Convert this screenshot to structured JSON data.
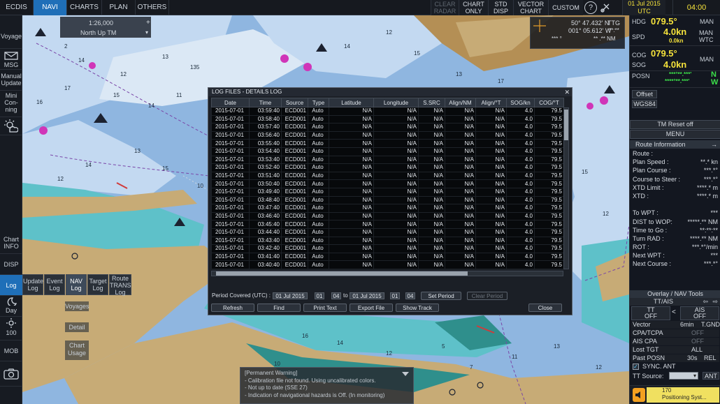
{
  "topbar": {
    "tabs": [
      {
        "label": "ECDIS",
        "active": false
      },
      {
        "label": "NAVI",
        "active": true
      },
      {
        "label": "CHARTS",
        "active": false
      },
      {
        "label": "PLAN",
        "active": false
      },
      {
        "label": "OTHERS",
        "active": false
      }
    ],
    "buttons": [
      "CLEAR\nRADAR",
      "CHART\nONLY",
      "STD\nDISP",
      "VECTOR\nCHART",
      "CUSTOM"
    ],
    "date": "01 Jul 2015",
    "date_zone": "UTC",
    "time": "04:00"
  },
  "left_menu": {
    "voyage": "Voyage",
    "msg": "MSG",
    "manual_update": "Manual\nUpdate",
    "mini_conning": "Mini\nCon-\nning",
    "chart_info": "Chart\nINFO",
    "disp": "DISP",
    "log": "Log",
    "day": "Day",
    "brightness": "100",
    "mob": "MOB"
  },
  "log_tabs": [
    {
      "label": "Update\nLog",
      "active": false
    },
    {
      "label": "Event\nLog",
      "active": false
    },
    {
      "label": "NAV\nLog",
      "active": true
    },
    {
      "label": "Target\nLog",
      "active": false
    },
    {
      "label": "Route\nTRANS\nLog",
      "active": false
    }
  ],
  "log_subitems": [
    "Voyages",
    "Detail",
    "Chart\nUsage"
  ],
  "chart_scale": {
    "scale": "1:26,000",
    "orientation": "North Up TM"
  },
  "cursor_readout": {
    "lat": "50° 47.432' N",
    "lon": "001° 05.612' W",
    "ttg": "TTG",
    "ttg_val": "**:**",
    "brg": "*** °",
    "rng": "** .** NM"
  },
  "nav": {
    "hdg_label": "HDG",
    "hdg": "079.5°",
    "hdg_mode": "MAN",
    "spd_label": "SPD",
    "spd": "4.0kn",
    "spd_sub": "0.0kn",
    "spd_mode": "MAN\nWTC",
    "cog_label": "COG",
    "cog": "079.5°",
    "cog_mode": "MAN",
    "sog_label": "SOG",
    "sog": "4.0kn",
    "posn_label": "POSN",
    "posn_lat": "***°**.***'",
    "posn_lat_dir": "N",
    "posn_lon": "****°**.***'",
    "posn_lon_dir": "W",
    "offset": "Offset",
    "datum": "WGS84"
  },
  "right_buttons": {
    "tm_reset": "TM Reset off",
    "menu": "MENU"
  },
  "route_info": {
    "title": "Route Information",
    "rows": [
      {
        "label": "Route :",
        "value": ""
      },
      {
        "label": "Plan Speed :",
        "value": "**.* kn"
      },
      {
        "label": "Plan Course :",
        "value": "***.*°"
      },
      {
        "label": "Course to Steer :",
        "value": "***.*°"
      },
      {
        "label": "XTD Limit :",
        "value": "****.* m"
      },
      {
        "label": "XTD :",
        "value": "****.* m"
      },
      {
        "label": "",
        "value": ""
      },
      {
        "label": "To WPT :",
        "value": "***"
      },
      {
        "label": "DIST to WOP:",
        "value": "*****.** NM"
      },
      {
        "label": "Time to Go :",
        "value": "**:**:**"
      },
      {
        "label": "Turn RAD :",
        "value": "****.** NM"
      },
      {
        "label": "ROT :",
        "value": "***.*°/min"
      },
      {
        "label": "Next WPT :",
        "value": "***"
      },
      {
        "label": "Next Course :",
        "value": "***.*°"
      }
    ]
  },
  "overlay": {
    "title": "Overlay / NAV Tools",
    "tab": "TT/AIS",
    "tt": "TT",
    "tt_state": "OFF",
    "ais": "AIS",
    "ais_state": "OFF",
    "vector": "Vector",
    "vector_time": "6min",
    "vector_mode": "T.GND",
    "cpa_tcpa": "CPA/TCPA",
    "cpa_state": "OFF",
    "ais_cpa": "AIS CPA",
    "ais_cpa_state": "OFF",
    "lost_tgt": "Lost TGT",
    "lost_state": "ALL",
    "past_posn": "Past POSN",
    "past_time": "30s",
    "past_mode": "REL",
    "sync_ant": "SYNC. ANT",
    "tt_source": "TT Source:",
    "ant": "ANT"
  },
  "alert": {
    "code": "170",
    "text": "Positioning Syst..."
  },
  "dialog": {
    "title": "LOG FILES - DETAILS LOG",
    "columns": [
      "Date",
      "Time",
      "Source",
      "Type",
      "Latitude",
      "Longitude",
      "S.SRC",
      "Align/NM",
      "Align/°T",
      "SOG/kn",
      "COG/°T"
    ],
    "rows": [
      [
        "2015-07-01",
        "03:59:40",
        "ECD001",
        "Auto",
        "N/A",
        "N/A",
        "N/A",
        "N/A",
        "N/A",
        "4.0",
        "79.5"
      ],
      [
        "2015-07-01",
        "03:58:40",
        "ECD001",
        "Auto",
        "N/A",
        "N/A",
        "N/A",
        "N/A",
        "N/A",
        "4.0",
        "79.5"
      ],
      [
        "2015-07-01",
        "03:57:40",
        "ECD001",
        "Auto",
        "N/A",
        "N/A",
        "N/A",
        "N/A",
        "N/A",
        "4.0",
        "79.5"
      ],
      [
        "2015-07-01",
        "03:56:40",
        "ECD001",
        "Auto",
        "N/A",
        "N/A",
        "N/A",
        "N/A",
        "N/A",
        "4.0",
        "79.5"
      ],
      [
        "2015-07-01",
        "03:55:40",
        "ECD001",
        "Auto",
        "N/A",
        "N/A",
        "N/A",
        "N/A",
        "N/A",
        "4.0",
        "79.5"
      ],
      [
        "2015-07-01",
        "03:54:40",
        "ECD001",
        "Auto",
        "N/A",
        "N/A",
        "N/A",
        "N/A",
        "N/A",
        "4.0",
        "79.5"
      ],
      [
        "2015-07-01",
        "03:53:40",
        "ECD001",
        "Auto",
        "N/A",
        "N/A",
        "N/A",
        "N/A",
        "N/A",
        "4.0",
        "79.5"
      ],
      [
        "2015-07-01",
        "03:52:40",
        "ECD001",
        "Auto",
        "N/A",
        "N/A",
        "N/A",
        "N/A",
        "N/A",
        "4.0",
        "79.5"
      ],
      [
        "2015-07-01",
        "03:51:40",
        "ECD001",
        "Auto",
        "N/A",
        "N/A",
        "N/A",
        "N/A",
        "N/A",
        "4.0",
        "79.5"
      ],
      [
        "2015-07-01",
        "03:50:40",
        "ECD001",
        "Auto",
        "N/A",
        "N/A",
        "N/A",
        "N/A",
        "N/A",
        "4.0",
        "79.5"
      ],
      [
        "2015-07-01",
        "03:49:40",
        "ECD001",
        "Auto",
        "N/A",
        "N/A",
        "N/A",
        "N/A",
        "N/A",
        "4.0",
        "79.5"
      ],
      [
        "2015-07-01",
        "03:48:40",
        "ECD001",
        "Auto",
        "N/A",
        "N/A",
        "N/A",
        "N/A",
        "N/A",
        "4.0",
        "79.5"
      ],
      [
        "2015-07-01",
        "03:47:40",
        "ECD001",
        "Auto",
        "N/A",
        "N/A",
        "N/A",
        "N/A",
        "N/A",
        "4.0",
        "79.5"
      ],
      [
        "2015-07-01",
        "03:46:40",
        "ECD001",
        "Auto",
        "N/A",
        "N/A",
        "N/A",
        "N/A",
        "N/A",
        "4.0",
        "79.5"
      ],
      [
        "2015-07-01",
        "03:45:40",
        "ECD001",
        "Auto",
        "N/A",
        "N/A",
        "N/A",
        "N/A",
        "N/A",
        "4.0",
        "79.5"
      ],
      [
        "2015-07-01",
        "03:44:40",
        "ECD001",
        "Auto",
        "N/A",
        "N/A",
        "N/A",
        "N/A",
        "N/A",
        "4.0",
        "79.5"
      ],
      [
        "2015-07-01",
        "03:43:40",
        "ECD001",
        "Auto",
        "N/A",
        "N/A",
        "N/A",
        "N/A",
        "N/A",
        "4.0",
        "79.5"
      ],
      [
        "2015-07-01",
        "03:42:40",
        "ECD001",
        "Auto",
        "N/A",
        "N/A",
        "N/A",
        "N/A",
        "N/A",
        "4.0",
        "79.5"
      ],
      [
        "2015-07-01",
        "03:41:40",
        "ECD001",
        "Auto",
        "N/A",
        "N/A",
        "N/A",
        "N/A",
        "N/A",
        "4.0",
        "79.5"
      ],
      [
        "2015-07-01",
        "03:40:40",
        "ECD001",
        "Auto",
        "N/A",
        "N/A",
        "N/A",
        "N/A",
        "N/A",
        "4.0",
        "79.5"
      ]
    ],
    "period_label": "Period Covered (UTC) :",
    "from_date": "01 Jul 2015",
    "from_h": "01",
    "from_m": "04",
    "to_label": "to",
    "to_date": "01 Jul 2015",
    "to_h": "01",
    "to_m": "04",
    "set_period": "Set Period",
    "clear_period": "Clear Period",
    "buttons": [
      "Refresh",
      "Find",
      "Print Text",
      "Export File",
      "Show Track"
    ],
    "close": "Close"
  },
  "warning": {
    "title": "[Permanent Warning]",
    "lines": [
      "- Calibration file not found. Using uncalibrated colors.",
      "- Not up to date (SSE 27)",
      "- Indication of navigational hazards is Off. (In monitoring)"
    ]
  },
  "colors": {
    "accent": "#1f6fb8",
    "yellow": "#f5e23b",
    "green": "#3ce04a",
    "land": "#c7ab76",
    "shallow": "#5ec1c9"
  }
}
